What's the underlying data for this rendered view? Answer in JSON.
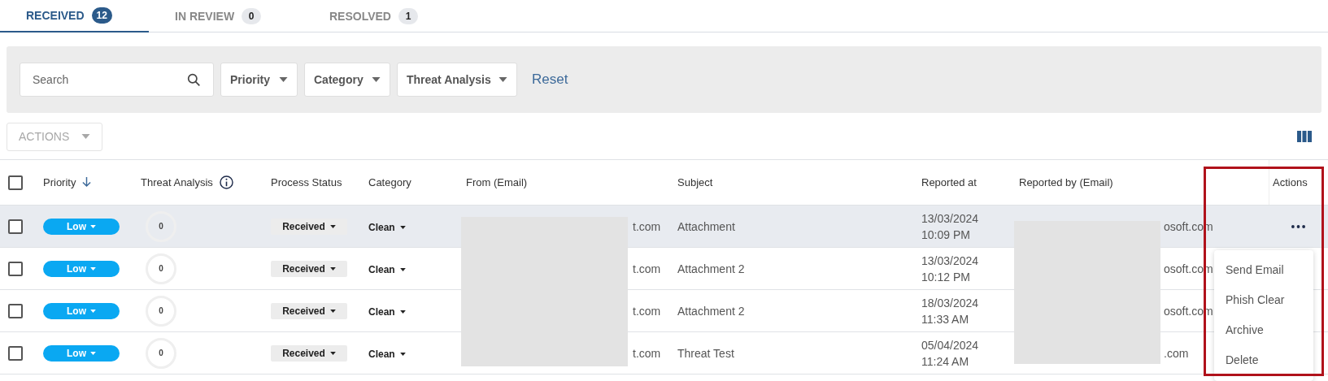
{
  "tabs": [
    {
      "label": "RECEIVED",
      "count": "12",
      "selected": true
    },
    {
      "label": "IN REVIEW",
      "count": "0",
      "selected": false
    },
    {
      "label": "RESOLVED",
      "count": "1",
      "selected": false
    }
  ],
  "filters": {
    "search": {
      "placeholder": "Search"
    },
    "dropdowns": [
      "Priority",
      "Category",
      "Threat Analysis"
    ],
    "reset": "Reset"
  },
  "toolbar": {
    "actions": {
      "label": "ACTIONS",
      "disabled": true
    }
  },
  "table": {
    "columns": [
      "Priority",
      "Threat Analysis",
      "Process Status",
      "Category",
      "From (Email)",
      "Subject",
      "Reported at",
      "Reported by (Email)",
      "Actions"
    ],
    "header_checked": false,
    "rows": [
      {
        "checked": false,
        "highlighted": true,
        "priority": "Low",
        "threat": "0",
        "status": "Received",
        "category": "Clean",
        "from": "t.com",
        "subject": "Attachment",
        "date": "13/03/2024",
        "time": "10:09 PM",
        "reported_by": "osoft.com",
        "show_actions": true
      },
      {
        "checked": false,
        "highlighted": false,
        "priority": "Low",
        "threat": "0",
        "status": "Received",
        "category": "Clean",
        "from": "t.com",
        "subject": "Attachment 2",
        "date": "13/03/2024",
        "time": "10:12 PM",
        "reported_by": "osoft.com",
        "show_actions": false
      },
      {
        "checked": false,
        "highlighted": false,
        "priority": "Low",
        "threat": "0",
        "status": "Received",
        "category": "Clean",
        "from": "t.com",
        "subject": "Attachment 2",
        "date": "18/03/2024",
        "time": "11:33 AM",
        "reported_by": "osoft.com",
        "show_actions": false
      },
      {
        "checked": false,
        "highlighted": false,
        "priority": "Low",
        "threat": "0",
        "status": "Received",
        "category": "Clean",
        "from": "t.com",
        "subject": "Threat Test",
        "date": "05/04/2024",
        "time": "11:24 AM",
        "reported_by": ".com",
        "show_actions": false
      }
    ]
  },
  "menu": {
    "items": [
      "Send Email",
      "Phish Clear",
      "Archive",
      "Delete"
    ]
  }
}
